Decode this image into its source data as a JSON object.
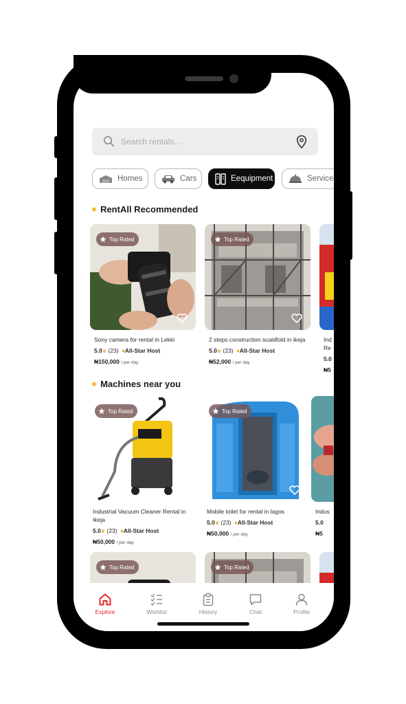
{
  "search": {
    "placeholder": "Search rentals..."
  },
  "categories": [
    {
      "label": "Homes",
      "icon": "house-icon",
      "active": false
    },
    {
      "label": "Cars",
      "icon": "car-icon",
      "active": false
    },
    {
      "label": "Eequipment",
      "icon": "equipment-icon",
      "active": true
    },
    {
      "label": "Services",
      "icon": "service-bell-icon",
      "active": false
    }
  ],
  "sections": [
    {
      "title": "RentAll Recommended",
      "cards": [
        {
          "badge": "Top Rated",
          "name": "Sony camera for rental in Lekki",
          "rating": "5.0",
          "reviews": "(23)",
          "host": "All-Star Host",
          "price": "₦150,000",
          "per": "/ per day"
        },
        {
          "badge": "Top Rated",
          "name": "2 steps construction scaldfold in ikeja",
          "rating": "5.0",
          "reviews": "(23)",
          "host": "All-Star Host",
          "price": "₦52,000",
          "per": "/ per day"
        },
        {
          "badge": "",
          "name": "Ind Re",
          "rating": "5.0",
          "reviews": "",
          "host": "",
          "price": "₦5",
          "per": ""
        }
      ]
    },
    {
      "title": "Machines near you",
      "cards": [
        {
          "badge": "Top Rated",
          "name": "Industrial Vacuum Cleaner Rental in Ikeja",
          "rating": "5.0",
          "reviews": "(23)",
          "host": "All-Star Host",
          "price": "₦50,000",
          "per": "/ per day"
        },
        {
          "badge": "Top Rated",
          "name": "Mobile toilet for rental in lagos",
          "rating": "5.0",
          "reviews": "(23)",
          "host": "All-Star Host",
          "price": "₦50,000",
          "per": "/ per day"
        },
        {
          "badge": "",
          "name": "Indus",
          "rating": "5.0",
          "reviews": "",
          "host": "",
          "price": "₦5",
          "per": ""
        }
      ]
    },
    {
      "title": "",
      "cards": [
        {
          "badge": "Top Rated"
        },
        {
          "badge": "Top Rated"
        }
      ]
    }
  ],
  "nav": [
    {
      "label": "Explore",
      "icon": "home-icon",
      "active": true
    },
    {
      "label": "Wishlist",
      "icon": "checklist-icon",
      "active": false
    },
    {
      "label": "History",
      "icon": "clipboard-icon",
      "active": false
    },
    {
      "label": "Chat",
      "icon": "chat-bubble-icon",
      "active": false
    },
    {
      "label": "Profile",
      "icon": "person-icon",
      "active": false
    }
  ],
  "colors": {
    "accent": "#e5231e",
    "active_chip": "#0d0d0d",
    "badge": "#785555"
  }
}
